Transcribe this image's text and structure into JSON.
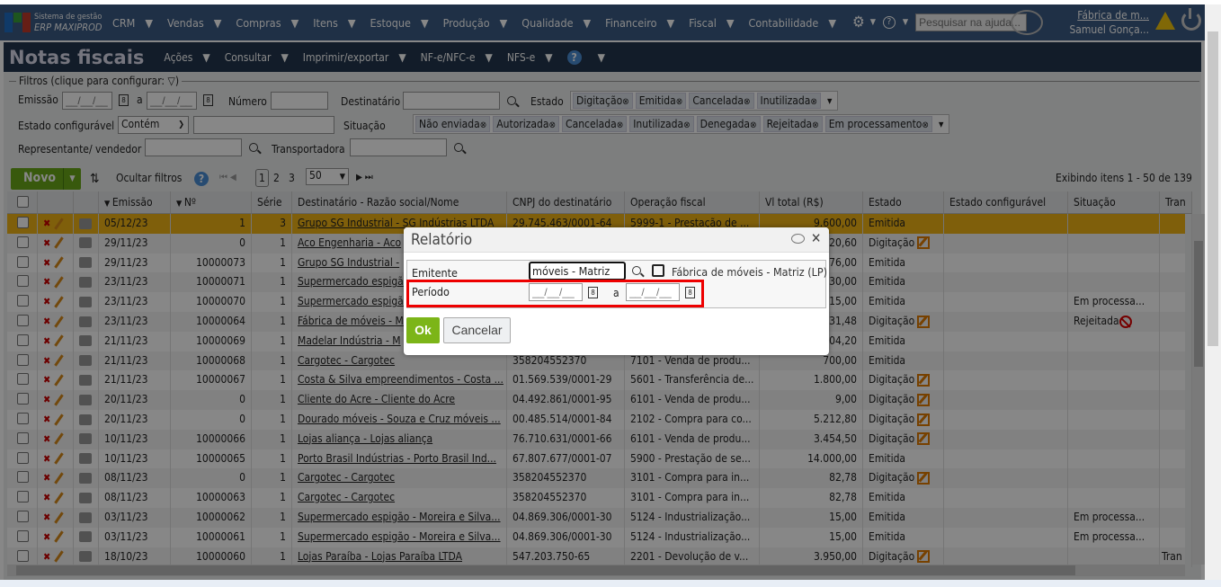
{
  "app": {
    "logo_line1": "Sistema de gestão",
    "logo_line2": "ERP MAXIPROD",
    "logo_colors": [
      "#1f6fc5",
      "#3aa03a",
      "#e8b400",
      "#c0392b"
    ]
  },
  "nav": {
    "items": [
      "CRM",
      "Vendas",
      "Compras",
      "Itens",
      "Estoque",
      "Produção",
      "Qualidade",
      "Financeiro",
      "Fiscal",
      "Contabilidade"
    ],
    "help_search_placeholder": "Pesquisar na ajuda...",
    "company": "Fábrica de m...",
    "user": "Samuel Gonça..."
  },
  "title": {
    "text": "Notas fiscais",
    "menus": [
      "Ações",
      "Consultar",
      "Imprimir/exportar",
      "NF-e/NFC-e",
      "NFS-e"
    ],
    "help": "?"
  },
  "filters": {
    "legend": "Filtros (clique para configurar:",
    "emissao_label": "Emissão",
    "date_placeholder": "__/__/__",
    "a": "a",
    "numero_label": "Número",
    "destinatario_label": "Destinatário",
    "estado_label": "Estado",
    "estado_tags": [
      "Digitação",
      "Emitida",
      "Cancelada",
      "Inutilizada"
    ],
    "estado_conf_label": "Estado configurável",
    "estado_conf_op": "Contém",
    "situacao_label": "Situação",
    "situacao_tags": [
      "Não enviada",
      "Autorizada",
      "Cancelada",
      "Inutilizada",
      "Denegada",
      "Rejeitada",
      "Em processamento"
    ],
    "representante_label": "Representante/ vendedor",
    "transportadora_label": "Transportadora"
  },
  "toolbar": {
    "novo": "Novo",
    "ocultar": "Ocultar filtros",
    "pages": [
      "1",
      "2",
      "3"
    ],
    "per_page": "50",
    "info": "Exibindo itens 1 - 50 de 139"
  },
  "table": {
    "headers": [
      "Emissão",
      "Nº",
      "Série",
      "Destinatário - Razão social/Nome",
      "CNPJ do destinatário",
      "Operação fiscal",
      "Vl total (R$)",
      "Estado",
      "Estado configurável",
      "Situação",
      "Tran"
    ],
    "rows": [
      [
        "05/12/23",
        "1",
        "3",
        "Grupo SG Industrial - SG Indústrias LTDA",
        "29.745.463/0001-64",
        "5999-1 - Prestação de ...",
        "9.600,00",
        "Emitida",
        "",
        ""
      ],
      [
        "29/11/23",
        "0",
        "1",
        "Aco Engenharia - Aco",
        "",
        "",
        "20,60",
        "Digitação",
        "",
        ""
      ],
      [
        "29/11/23",
        "10000073",
        "1",
        "Grupo SG Industrial -",
        "",
        "",
        "76,00",
        "Emitida",
        "",
        ""
      ],
      [
        "23/11/23",
        "10000071",
        "1",
        "Supermercado espigã",
        "",
        "",
        "30,00",
        "Emitida",
        "",
        ""
      ],
      [
        "23/11/23",
        "10000070",
        "1",
        "Supermercado espigã",
        "",
        "",
        "15,00",
        "Emitida",
        "",
        "Em processa..."
      ],
      [
        "23/11/23",
        "10000064",
        "1",
        "Fábrica de móveis - M",
        "",
        "",
        "31,48",
        "Digitação",
        "",
        "Rejeitada"
      ],
      [
        "21/11/23",
        "10000069",
        "1",
        "Madelar Indústria - M",
        "",
        "",
        "04,20",
        "Emitida",
        "",
        ""
      ],
      [
        "21/11/23",
        "10000068",
        "1",
        "Cargotec - Cargotec",
        "358204552370",
        "7101 - Venda de produ...",
        "700,00",
        "Emitida",
        "",
        ""
      ],
      [
        "21/11/23",
        "10000067",
        "1",
        "Costa & Silva empreendimentos - Costa ...",
        "01.569.539/0001-29",
        "5601 - Transferência de...",
        "1.800,00",
        "Digitação",
        "",
        ""
      ],
      [
        "20/11/23",
        "0",
        "1",
        "Cliente do Acre - Cliente do Acre",
        "04.492.861/0001-95",
        "6101 - Venda de produ...",
        "9,00",
        "Digitação",
        "",
        ""
      ],
      [
        "20/11/23",
        "0",
        "1",
        "Dourado móveis - Souza e Cruz móveis ...",
        "00.485.514/0001-84",
        "2102 - Compra para co...",
        "5.212,80",
        "Digitação",
        "",
        ""
      ],
      [
        "10/11/23",
        "10000066",
        "1",
        "Lojas aliança - Lojas aliança",
        "76.710.631/0001-66",
        "6101 - Venda de produ...",
        "3.454,50",
        "Digitação",
        "",
        ""
      ],
      [
        "10/11/23",
        "10000065",
        "1",
        "Porto Brasil Indústrias - Porto Brasil Ind...",
        "67.807.677/0001-07",
        "5900 - Prestação de se...",
        "14.000,00",
        "Emitida",
        "",
        ""
      ],
      [
        "08/11/23",
        "0",
        "1",
        "Cargotec - Cargotec",
        "358204552370",
        "3101 - Compra para in...",
        "82,78",
        "Digitação",
        "",
        ""
      ],
      [
        "08/11/23",
        "10000063",
        "1",
        "Cargotec - Cargotec",
        "358204552370",
        "3101 - Compra para in...",
        "82,78",
        "Emitida",
        "",
        ""
      ],
      [
        "03/11/23",
        "10000062",
        "1",
        "Supermercado espigão - Moreira e Silva...",
        "04.869.306/0001-30",
        "5124 - Industrialização...",
        "15,00",
        "Emitida",
        "",
        "Em processa..."
      ],
      [
        "03/11/23",
        "10000061",
        "1",
        "Supermercado espigão - Moreira e Silva...",
        "04.869.306/0001-30",
        "5124 - Industrialização...",
        "15,00",
        "Emitida",
        "",
        "Em processa..."
      ],
      [
        "18/10/23",
        "10000060",
        "1",
        "Lojas Paraíba - Lojas Paraíba LTDA",
        "547.203.750-65",
        "2201 - Devolução de v...",
        "3.950,00",
        "Digitação",
        "",
        "",
        "Tran"
      ]
    ]
  },
  "modal": {
    "title": "Relatório",
    "emitente_label": "Emitente",
    "emitente_value": "móveis - Matriz (LP)",
    "emitente_desc": "Fábrica de móveis - Matriz (LP)",
    "periodo_label": "Período",
    "date_placeholder": "__/__/__",
    "a": "a",
    "ok": "Ok",
    "cancel": "Cancelar"
  },
  "colors": {
    "accent": "#6aa81a",
    "selected_row": "#f0b416",
    "highlight": "#e00000"
  }
}
